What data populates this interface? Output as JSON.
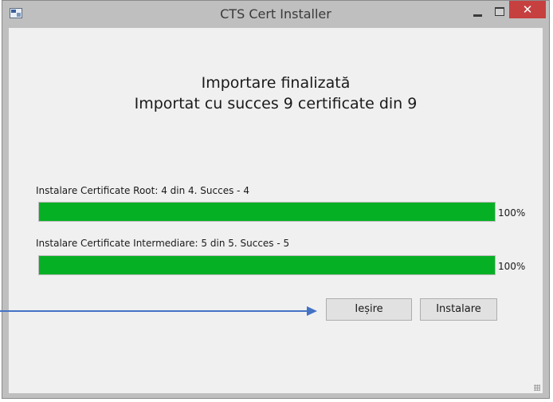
{
  "window": {
    "title": "CTS Cert Installer",
    "close_glyph": "✕"
  },
  "status": {
    "line1": "Importare finalizată",
    "line2": "Importat cu succes 9 certificate din 9"
  },
  "root": {
    "label": "Instalare Certificate Root:",
    "detail": "4 din 4. Succes - 4",
    "progress": 1.0,
    "percent_text": "100%"
  },
  "intermediate": {
    "label": "Instalare Certificate Intermediare:",
    "detail": "5 din 5. Succes - 5",
    "progress": 1.0,
    "percent_text": "100%"
  },
  "buttons": {
    "exit": "Ieșire",
    "install": "Instalare"
  },
  "colors": {
    "progress_fill": "#06b025",
    "close_button": "#c74040",
    "arrow": "#4472c4"
  },
  "icons": [
    "app-icon",
    "minimize-icon",
    "maximize-icon",
    "close-icon",
    "arrow-icon",
    "resize-grip-icon"
  ]
}
